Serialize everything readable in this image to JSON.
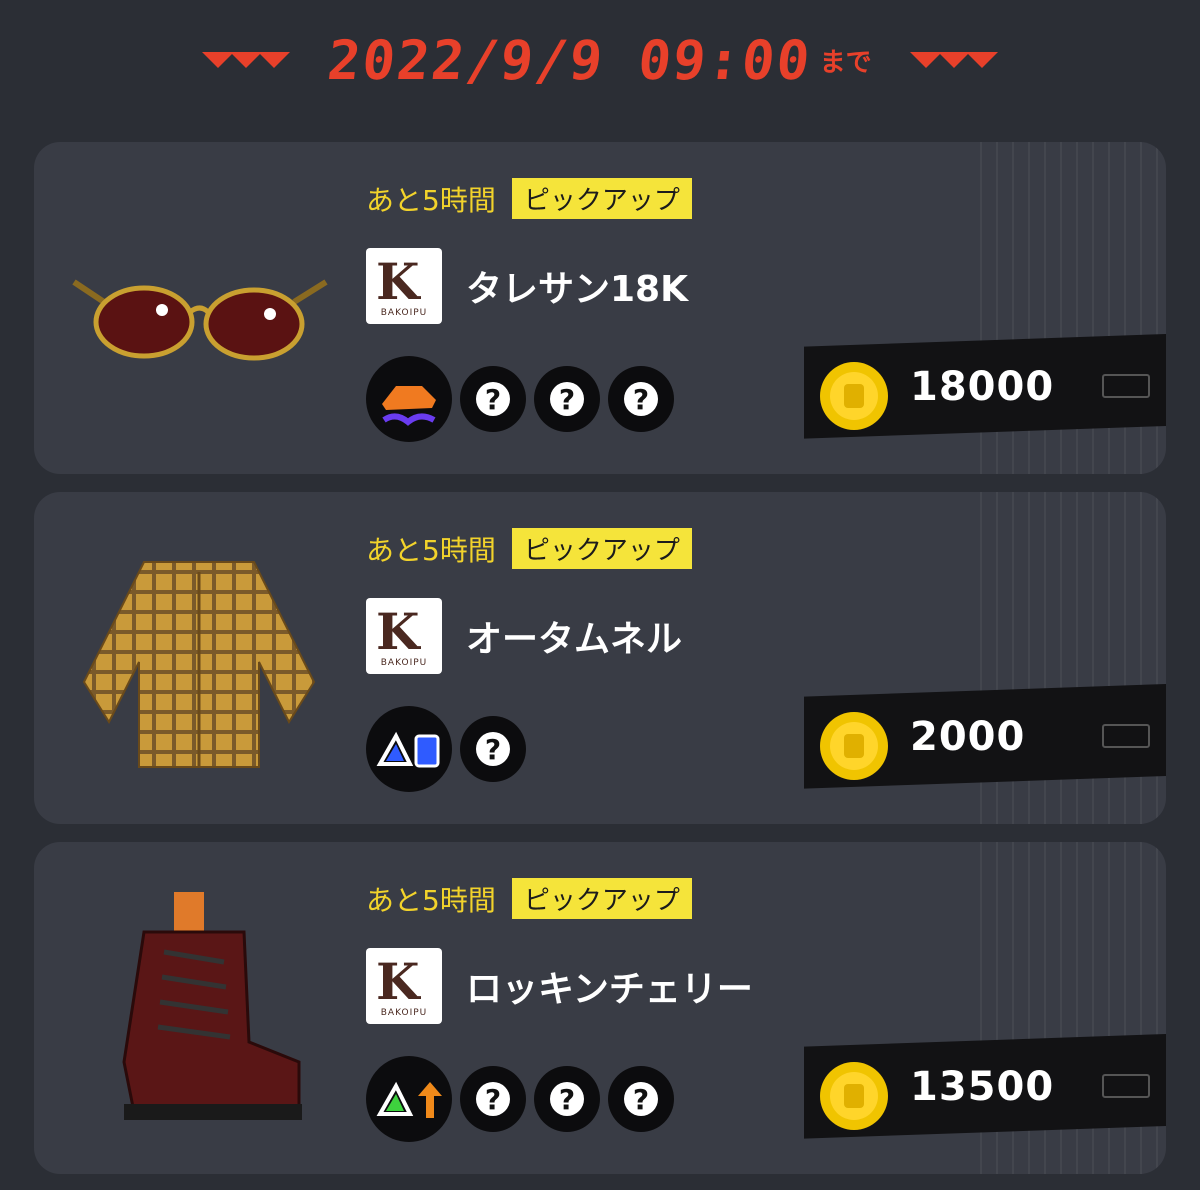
{
  "header": {
    "date": "2022/9/9 09:00",
    "suffix": "まで",
    "accent": "#e8402a"
  },
  "items": [
    {
      "time_left": "あと5時間",
      "badge": "ピックアップ",
      "brand_icon": "brand-logo-icon",
      "brand_text": "BAKOIPU",
      "name": "タレサン18K",
      "gear_icon": "sunglasses-icon",
      "main_ability": "swim-shoe-ability-icon",
      "sub_slots": [
        "?",
        "?",
        "?"
      ],
      "price": "18000"
    },
    {
      "time_left": "あと5時間",
      "badge": "ピックアップ",
      "brand_icon": "brand-logo-icon",
      "brand_text": "BAKOIPU",
      "name": "オータムネル",
      "gear_icon": "plaid-shirt-icon",
      "main_ability": "special-charge-ability-icon",
      "sub_slots": [
        "?"
      ],
      "price": "2000"
    },
    {
      "time_left": "あと5時間",
      "badge": "ピックアップ",
      "brand_icon": "brand-logo-icon",
      "brand_text": "BAKOIPU",
      "name": "ロッキンチェリー",
      "gear_icon": "boot-icon",
      "main_ability": "special-power-up-ability-icon",
      "sub_slots": [
        "?",
        "?",
        "?"
      ],
      "price": "13500"
    }
  ]
}
